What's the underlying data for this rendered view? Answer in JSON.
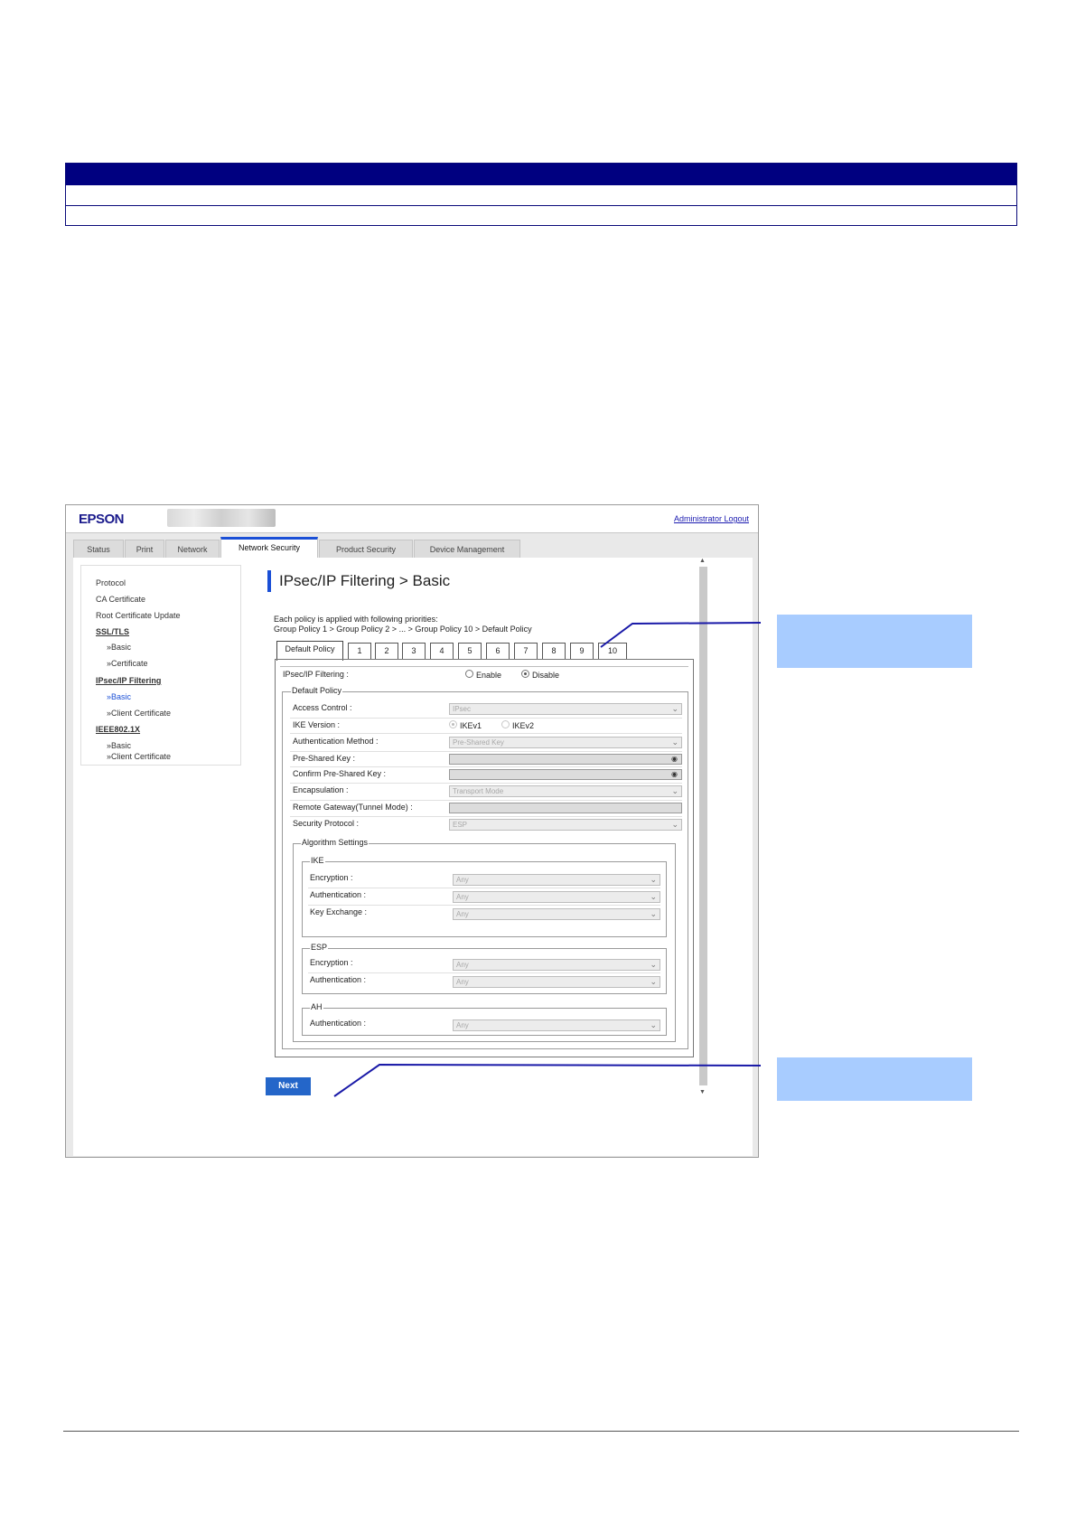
{
  "app": {
    "logo": "EPSON",
    "logout": "Administrator Logout"
  },
  "tabs": [
    "Status",
    "Print",
    "Network",
    "Network Security",
    "Product Security",
    "Device Management"
  ],
  "sidebar": {
    "items": [
      "Protocol",
      "CA Certificate",
      "Root Certificate Update",
      "SSL/TLS",
      "»Basic",
      "»Certificate",
      "IPsec/IP Filtering",
      "»Basic",
      "»Client Certificate",
      "IEEE802.1X",
      "»Basic",
      "»Client Certificate"
    ]
  },
  "page": {
    "title": "IPsec/IP Filtering > Basic",
    "priority_line1": "Each policy is applied with following priorities:",
    "priority_line2": "Group Policy 1 > Group Policy 2 > ... > Group Policy 10 > Default Policy"
  },
  "policy_tabs": [
    "Default Policy",
    "1",
    "2",
    "3",
    "4",
    "5",
    "6",
    "7",
    "8",
    "9",
    "10"
  ],
  "form": {
    "filtering_label": "IPsec/IP Filtering :",
    "enable": "Enable",
    "disable": "Disable",
    "default_policy_legend": "Default Policy",
    "access_control_label": "Access Control :",
    "access_control_value": "IPsec",
    "ike_version_label": "IKE Version :",
    "ikev1": "IKEv1",
    "ikev2": "IKEv2",
    "auth_method_label": "Authentication Method :",
    "auth_method_value": "Pre-Shared Key",
    "psk_label": "Pre-Shared Key :",
    "confirm_psk_label": "Confirm Pre-Shared Key :",
    "encapsulation_label": "Encapsulation :",
    "encapsulation_value": "Transport Mode",
    "remote_gw_label": "Remote Gateway(Tunnel Mode) :",
    "security_protocol_label": "Security Protocol :",
    "security_protocol_value": "ESP",
    "algorithm_legend": "Algorithm Settings",
    "ike_legend": "IKE",
    "ike_encryption_label": "Encryption :",
    "ike_authentication_label": "Authentication :",
    "ike_key_exchange_label": "Key Exchange :",
    "esp_legend": "ESP",
    "esp_encryption_label": "Encryption :",
    "esp_authentication_label": "Authentication :",
    "ah_legend": "AH",
    "ah_authentication_label": "Authentication :",
    "any": "Any",
    "next": "Next"
  },
  "icons": {
    "eye": "eye-icon",
    "chevron": "chevron-down-icon"
  },
  "colors": {
    "accent": "#1a4fd6",
    "header_bar": "#000080",
    "callout": "#a8ccff",
    "leader_line": "#1a1aa8"
  }
}
